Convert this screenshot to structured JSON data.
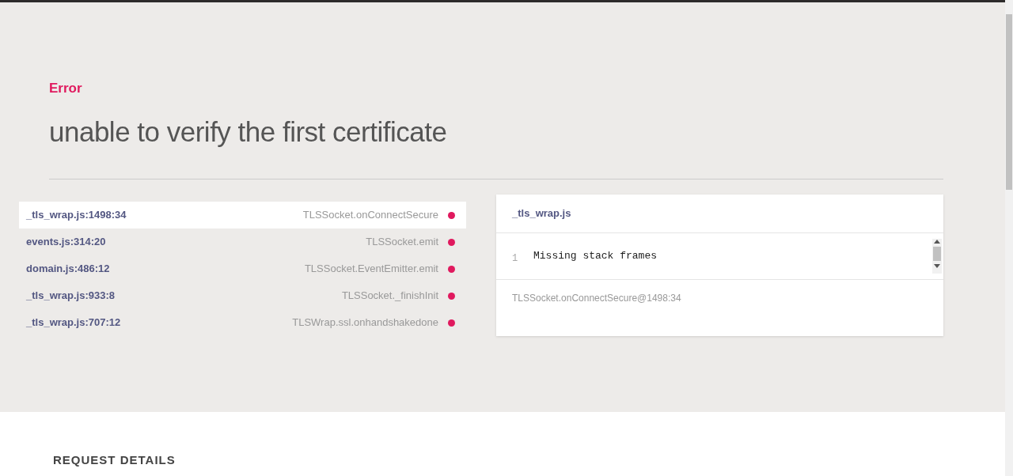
{
  "error": {
    "label": "Error",
    "message": "unable to verify the first certificate"
  },
  "frames": [
    {
      "file": "_tls_wrap.js:1498:34",
      "method": "TLSSocket.onConnectSecure",
      "selected": true
    },
    {
      "file": "events.js:314:20",
      "method": "TLSSocket.emit",
      "selected": false
    },
    {
      "file": "domain.js:486:12",
      "method": "TLSSocket.EventEmitter.emit",
      "selected": false
    },
    {
      "file": "_tls_wrap.js:933:8",
      "method": "TLSSocket._finishInit",
      "selected": false
    },
    {
      "file": "_tls_wrap.js:707:12",
      "method": "TLSWrap.ssl.onhandshakedone",
      "selected": false
    }
  ],
  "code_panel": {
    "file": "_tls_wrap.js",
    "lines": [
      {
        "number": "1",
        "code": "Missing stack frames"
      }
    ],
    "location": "TLSSocket.onConnectSecure@1498:34"
  },
  "request_details": {
    "title": "REQUEST DETAILS"
  }
}
